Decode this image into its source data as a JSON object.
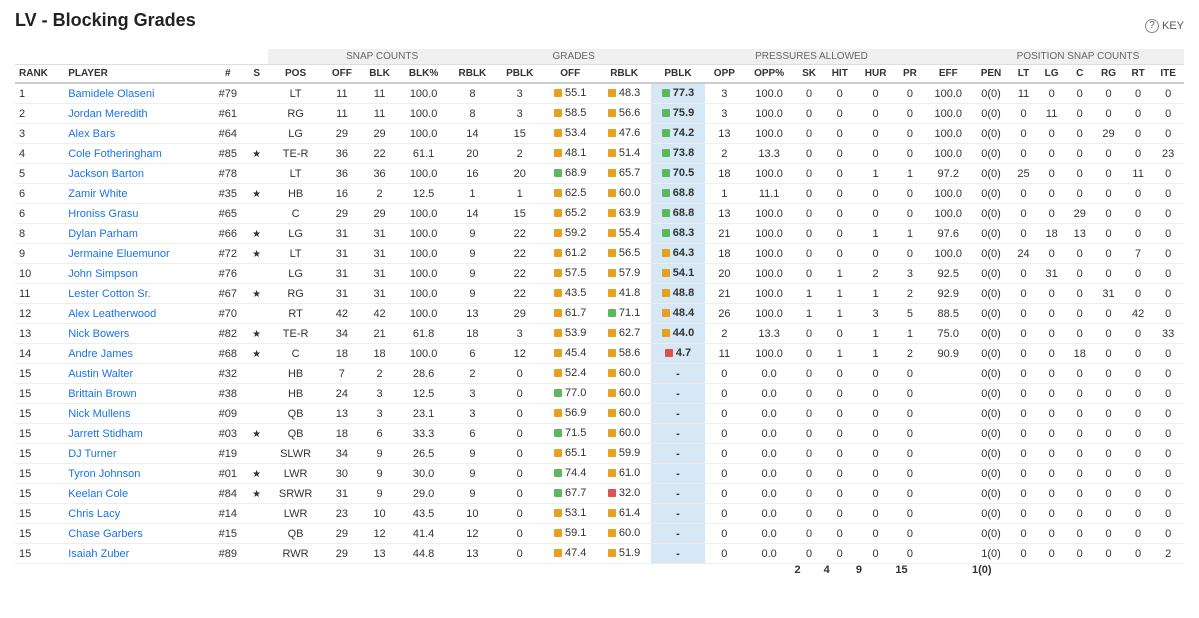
{
  "title": "LV - Blocking Grades",
  "key_label": "KEY",
  "group_headers": [
    {
      "label": "",
      "colspan": 4,
      "class": ""
    },
    {
      "label": "SNAP COUNTS",
      "colspan": 5,
      "class": "snap-counts"
    },
    {
      "label": "GRADES",
      "colspan": 3,
      "class": "grades"
    },
    {
      "label": "PRESSURES ALLOWED",
      "colspan": 8,
      "class": "pressures"
    },
    {
      "label": "POSITION SNAP COUNTS",
      "colspan": 7,
      "class": "pos-snap"
    }
  ],
  "col_headers": [
    "RANK",
    "PLAYER",
    "#",
    "S",
    "POS",
    "OFF",
    "BLK",
    "BLK%",
    "RBLK",
    "PBLK",
    "OFF",
    "RBLK",
    "PBLK",
    "OPP",
    "OPP%",
    "SK",
    "HIT",
    "HUR",
    "PR",
    "EFF",
    "PEN",
    "LT",
    "LG",
    "C",
    "RG",
    "RT",
    "ITE"
  ],
  "rows": [
    {
      "rank": "1",
      "player": "Bamidele Olaseni",
      "num": "#79",
      "star": false,
      "pos": "LT",
      "off": "11",
      "blk": "11",
      "blk_pct": "100.0",
      "rblk": "8",
      "pblk": "3",
      "off_grade": "55.1",
      "off_color": "#e8a020",
      "rblk_grade": "48.3",
      "rblk_color": "#e8a020",
      "pblk_grade": "77.3",
      "pblk_color": "#5cb85c",
      "opp": "3",
      "opp_pct": "100.0",
      "sk": "0",
      "hit": "0",
      "hur": "0",
      "pr": "0",
      "eff": "100.0",
      "pen": "0(0)",
      "lt": "11",
      "lg": "0",
      "c": "0",
      "rg": "0",
      "rt": "0",
      "ite": "0"
    },
    {
      "rank": "2",
      "player": "Jordan Meredith",
      "num": "#61",
      "star": false,
      "pos": "RG",
      "off": "11",
      "blk": "11",
      "blk_pct": "100.0",
      "rblk": "8",
      "pblk": "3",
      "off_grade": "58.5",
      "off_color": "#e8a020",
      "rblk_grade": "56.6",
      "rblk_color": "#e8a020",
      "pblk_grade": "75.9",
      "pblk_color": "#5cb85c",
      "opp": "3",
      "opp_pct": "100.0",
      "sk": "0",
      "hit": "0",
      "hur": "0",
      "pr": "0",
      "eff": "100.0",
      "pen": "0(0)",
      "lt": "0",
      "lg": "11",
      "c": "0",
      "rg": "0",
      "rt": "0",
      "ite": "0"
    },
    {
      "rank": "3",
      "player": "Alex Bars",
      "num": "#64",
      "star": false,
      "pos": "LG",
      "off": "29",
      "blk": "29",
      "blk_pct": "100.0",
      "rblk": "14",
      "pblk": "15",
      "off_grade": "53.4",
      "off_color": "#e8a020",
      "rblk_grade": "47.6",
      "rblk_color": "#e8a020",
      "pblk_grade": "74.2",
      "pblk_color": "#5cb85c",
      "opp": "13",
      "opp_pct": "100.0",
      "sk": "0",
      "hit": "0",
      "hur": "0",
      "pr": "0",
      "eff": "100.0",
      "pen": "0(0)",
      "lt": "0",
      "lg": "0",
      "c": "0",
      "rg": "29",
      "rt": "0",
      "ite": "0"
    },
    {
      "rank": "4",
      "player": "Cole Fotheringham",
      "num": "#85",
      "star": true,
      "pos": "TE-R",
      "off": "36",
      "blk": "22",
      "blk_pct": "61.1",
      "rblk": "20",
      "pblk": "2",
      "off_grade": "48.1",
      "off_color": "#e8a020",
      "rblk_grade": "51.4",
      "rblk_color": "#e8a020",
      "pblk_grade": "73.8",
      "pblk_color": "#5cb85c",
      "opp": "2",
      "opp_pct": "13.3",
      "sk": "0",
      "hit": "0",
      "hur": "0",
      "pr": "0",
      "eff": "100.0",
      "pen": "0(0)",
      "lt": "0",
      "lg": "0",
      "c": "0",
      "rg": "0",
      "rt": "0",
      "ite": "23"
    },
    {
      "rank": "5",
      "player": "Jackson Barton",
      "num": "#78",
      "star": false,
      "pos": "LT",
      "off": "36",
      "blk": "36",
      "blk_pct": "100.0",
      "rblk": "16",
      "pblk": "20",
      "off_grade": "68.9",
      "off_color": "#5cb85c",
      "rblk_grade": "65.7",
      "rblk_color": "#e8a020",
      "pblk_grade": "70.5",
      "pblk_color": "#5cb85c",
      "opp": "18",
      "opp_pct": "100.0",
      "sk": "0",
      "hit": "0",
      "hur": "1",
      "pr": "1",
      "eff": "97.2",
      "pen": "0(0)",
      "lt": "25",
      "lg": "0",
      "c": "0",
      "rg": "0",
      "rt": "11",
      "ite": "0"
    },
    {
      "rank": "6",
      "player": "Zamir White",
      "num": "#35",
      "star": true,
      "pos": "HB",
      "off": "16",
      "blk": "2",
      "blk_pct": "12.5",
      "rblk": "1",
      "pblk": "1",
      "off_grade": "62.5",
      "off_color": "#e8a020",
      "rblk_grade": "60.0",
      "rblk_color": "#e8a020",
      "pblk_grade": "68.8",
      "pblk_color": "#5cb85c",
      "opp": "1",
      "opp_pct": "11.1",
      "sk": "0",
      "hit": "0",
      "hur": "0",
      "pr": "0",
      "eff": "100.0",
      "pen": "0(0)",
      "lt": "0",
      "lg": "0",
      "c": "0",
      "rg": "0",
      "rt": "0",
      "ite": "0"
    },
    {
      "rank": "6",
      "player": "Hroniss Grasu",
      "num": "#65",
      "star": false,
      "pos": "C",
      "off": "29",
      "blk": "29",
      "blk_pct": "100.0",
      "rblk": "14",
      "pblk": "15",
      "off_grade": "65.2",
      "off_color": "#e8a020",
      "rblk_grade": "63.9",
      "rblk_color": "#e8a020",
      "pblk_grade": "68.8",
      "pblk_color": "#5cb85c",
      "opp": "13",
      "opp_pct": "100.0",
      "sk": "0",
      "hit": "0",
      "hur": "0",
      "pr": "0",
      "eff": "100.0",
      "pen": "0(0)",
      "lt": "0",
      "lg": "0",
      "c": "29",
      "rg": "0",
      "rt": "0",
      "ite": "0"
    },
    {
      "rank": "8",
      "player": "Dylan Parham",
      "num": "#66",
      "star": true,
      "pos": "LG",
      "off": "31",
      "blk": "31",
      "blk_pct": "100.0",
      "rblk": "9",
      "pblk": "22",
      "off_grade": "59.2",
      "off_color": "#e8a020",
      "rblk_grade": "55.4",
      "rblk_color": "#e8a020",
      "pblk_grade": "68.3",
      "pblk_color": "#5cb85c",
      "opp": "21",
      "opp_pct": "100.0",
      "sk": "0",
      "hit": "0",
      "hur": "1",
      "pr": "1",
      "eff": "97.6",
      "pen": "0(0)",
      "lt": "0",
      "lg": "18",
      "c": "13",
      "rg": "0",
      "rt": "0",
      "ite": "0"
    },
    {
      "rank": "9",
      "player": "Jermaine Eluemunor",
      "num": "#72",
      "star": true,
      "pos": "LT",
      "off": "31",
      "blk": "31",
      "blk_pct": "100.0",
      "rblk": "9",
      "pblk": "22",
      "off_grade": "61.2",
      "off_color": "#e8a020",
      "rblk_grade": "56.5",
      "rblk_color": "#e8a020",
      "pblk_grade": "64.3",
      "pblk_color": "#e8a020",
      "opp": "18",
      "opp_pct": "100.0",
      "sk": "0",
      "hit": "0",
      "hur": "0",
      "pr": "0",
      "eff": "100.0",
      "pen": "0(0)",
      "lt": "24",
      "lg": "0",
      "c": "0",
      "rg": "0",
      "rt": "7",
      "ite": "0"
    },
    {
      "rank": "10",
      "player": "John Simpson",
      "num": "#76",
      "star": false,
      "pos": "LG",
      "off": "31",
      "blk": "31",
      "blk_pct": "100.0",
      "rblk": "9",
      "pblk": "22",
      "off_grade": "57.5",
      "off_color": "#e8a020",
      "rblk_grade": "57.9",
      "rblk_color": "#e8a020",
      "pblk_grade": "54.1",
      "pblk_color": "#e8a020",
      "opp": "20",
      "opp_pct": "100.0",
      "sk": "0",
      "hit": "1",
      "hur": "2",
      "pr": "3",
      "eff": "92.5",
      "pen": "0(0)",
      "lt": "0",
      "lg": "31",
      "c": "0",
      "rg": "0",
      "rt": "0",
      "ite": "0"
    },
    {
      "rank": "11",
      "player": "Lester Cotton Sr.",
      "num": "#67",
      "star": true,
      "pos": "RG",
      "off": "31",
      "blk": "31",
      "blk_pct": "100.0",
      "rblk": "9",
      "pblk": "22",
      "off_grade": "43.5",
      "off_color": "#e8a020",
      "rblk_grade": "41.8",
      "rblk_color": "#e8a020",
      "pblk_grade": "48.8",
      "pblk_color": "#e8a020",
      "opp": "21",
      "opp_pct": "100.0",
      "sk": "1",
      "hit": "1",
      "hur": "1",
      "pr": "2",
      "eff": "92.9",
      "pen": "0(0)",
      "lt": "0",
      "lg": "0",
      "c": "0",
      "rg": "31",
      "rt": "0",
      "ite": "0"
    },
    {
      "rank": "12",
      "player": "Alex Leatherwood",
      "num": "#70",
      "star": false,
      "pos": "RT",
      "off": "42",
      "blk": "42",
      "blk_pct": "100.0",
      "rblk": "13",
      "pblk": "29",
      "off_grade": "61.7",
      "off_color": "#e8a020",
      "rblk_grade": "71.1",
      "rblk_color": "#5cb85c",
      "pblk_grade": "48.4",
      "pblk_color": "#e8a020",
      "opp": "26",
      "opp_pct": "100.0",
      "sk": "1",
      "hit": "1",
      "hur": "3",
      "pr": "5",
      "eff": "88.5",
      "pen": "0(0)",
      "lt": "0",
      "lg": "0",
      "c": "0",
      "rg": "0",
      "rt": "42",
      "ite": "0"
    },
    {
      "rank": "13",
      "player": "Nick Bowers",
      "num": "#82",
      "star": true,
      "pos": "TE-R",
      "off": "34",
      "blk": "21",
      "blk_pct": "61.8",
      "rblk": "18",
      "pblk": "3",
      "off_grade": "53.9",
      "off_color": "#e8a020",
      "rblk_grade": "62.7",
      "rblk_color": "#e8a020",
      "pblk_grade": "44.0",
      "pblk_color": "#e8a020",
      "opp": "2",
      "opp_pct": "13.3",
      "sk": "0",
      "hit": "0",
      "hur": "1",
      "pr": "1",
      "eff": "75.0",
      "pen": "0(0)",
      "lt": "0",
      "lg": "0",
      "c": "0",
      "rg": "0",
      "rt": "0",
      "ite": "33"
    },
    {
      "rank": "14",
      "player": "Andre James",
      "num": "#68",
      "star": true,
      "pos": "C",
      "off": "18",
      "blk": "18",
      "blk_pct": "100.0",
      "rblk": "6",
      "pblk": "12",
      "off_grade": "45.4",
      "off_color": "#e8a020",
      "rblk_grade": "58.6",
      "rblk_color": "#e8a020",
      "pblk_grade": "4.7",
      "pblk_color": "#d9534f",
      "opp": "11",
      "opp_pct": "100.0",
      "sk": "0",
      "hit": "1",
      "hur": "1",
      "pr": "2",
      "eff": "90.9",
      "pen": "0(0)",
      "lt": "0",
      "lg": "0",
      "c": "18",
      "rg": "0",
      "rt": "0",
      "ite": "0"
    },
    {
      "rank": "15",
      "player": "Austin Walter",
      "num": "#32",
      "star": false,
      "pos": "HB",
      "off": "7",
      "blk": "2",
      "blk_pct": "28.6",
      "rblk": "2",
      "pblk": "0",
      "off_grade": "52.4",
      "off_color": "#e8a020",
      "rblk_grade": "60.0",
      "rblk_color": "#e8a020",
      "pblk_grade": "-",
      "pblk_color": "",
      "opp": "0",
      "opp_pct": "0.0",
      "sk": "0",
      "hit": "0",
      "hur": "0",
      "pr": "0",
      "eff": "",
      "pen": "0(0)",
      "lt": "0",
      "lg": "0",
      "c": "0",
      "rg": "0",
      "rt": "0",
      "ite": "0"
    },
    {
      "rank": "15",
      "player": "Brittain Brown",
      "num": "#38",
      "star": false,
      "pos": "HB",
      "off": "24",
      "blk": "3",
      "blk_pct": "12.5",
      "rblk": "3",
      "pblk": "0",
      "off_grade": "77.0",
      "off_color": "#5cb85c",
      "rblk_grade": "60.0",
      "rblk_color": "#e8a020",
      "pblk_grade": "-",
      "pblk_color": "",
      "opp": "0",
      "opp_pct": "0.0",
      "sk": "0",
      "hit": "0",
      "hur": "0",
      "pr": "0",
      "eff": "",
      "pen": "0(0)",
      "lt": "0",
      "lg": "0",
      "c": "0",
      "rg": "0",
      "rt": "0",
      "ite": "0"
    },
    {
      "rank": "15",
      "player": "Nick Mullens",
      "num": "#09",
      "star": false,
      "pos": "QB",
      "off": "13",
      "blk": "3",
      "blk_pct": "23.1",
      "rblk": "3",
      "pblk": "0",
      "off_grade": "56.9",
      "off_color": "#e8a020",
      "rblk_grade": "60.0",
      "rblk_color": "#e8a020",
      "pblk_grade": "-",
      "pblk_color": "",
      "opp": "0",
      "opp_pct": "0.0",
      "sk": "0",
      "hit": "0",
      "hur": "0",
      "pr": "0",
      "eff": "",
      "pen": "0(0)",
      "lt": "0",
      "lg": "0",
      "c": "0",
      "rg": "0",
      "rt": "0",
      "ite": "0"
    },
    {
      "rank": "15",
      "player": "Jarrett Stidham",
      "num": "#03",
      "star": true,
      "pos": "QB",
      "off": "18",
      "blk": "6",
      "blk_pct": "33.3",
      "rblk": "6",
      "pblk": "0",
      "off_grade": "71.5",
      "off_color": "#5cb85c",
      "rblk_grade": "60.0",
      "rblk_color": "#e8a020",
      "pblk_grade": "-",
      "pblk_color": "",
      "opp": "0",
      "opp_pct": "0.0",
      "sk": "0",
      "hit": "0",
      "hur": "0",
      "pr": "0",
      "eff": "",
      "pen": "0(0)",
      "lt": "0",
      "lg": "0",
      "c": "0",
      "rg": "0",
      "rt": "0",
      "ite": "0"
    },
    {
      "rank": "15",
      "player": "DJ Turner",
      "num": "#19",
      "star": false,
      "pos": "SLWR",
      "off": "34",
      "blk": "9",
      "blk_pct": "26.5",
      "rblk": "9",
      "pblk": "0",
      "off_grade": "65.1",
      "off_color": "#e8a020",
      "rblk_grade": "59.9",
      "rblk_color": "#e8a020",
      "pblk_grade": "-",
      "pblk_color": "",
      "opp": "0",
      "opp_pct": "0.0",
      "sk": "0",
      "hit": "0",
      "hur": "0",
      "pr": "0",
      "eff": "",
      "pen": "0(0)",
      "lt": "0",
      "lg": "0",
      "c": "0",
      "rg": "0",
      "rt": "0",
      "ite": "0"
    },
    {
      "rank": "15",
      "player": "Tyron Johnson",
      "num": "#01",
      "star": true,
      "pos": "LWR",
      "off": "30",
      "blk": "9",
      "blk_pct": "30.0",
      "rblk": "9",
      "pblk": "0",
      "off_grade": "74.4",
      "off_color": "#5cb85c",
      "rblk_grade": "61.0",
      "rblk_color": "#e8a020",
      "pblk_grade": "-",
      "pblk_color": "",
      "opp": "0",
      "opp_pct": "0.0",
      "sk": "0",
      "hit": "0",
      "hur": "0",
      "pr": "0",
      "eff": "",
      "pen": "0(0)",
      "lt": "0",
      "lg": "0",
      "c": "0",
      "rg": "0",
      "rt": "0",
      "ite": "0"
    },
    {
      "rank": "15",
      "player": "Keelan Cole",
      "num": "#84",
      "star": true,
      "pos": "SRWR",
      "off": "31",
      "blk": "9",
      "blk_pct": "29.0",
      "rblk": "9",
      "pblk": "0",
      "off_grade": "67.7",
      "off_color": "#5cb85c",
      "rblk_grade": "32.0",
      "rblk_color": "#d9534f",
      "pblk_grade": "-",
      "pblk_color": "",
      "opp": "0",
      "opp_pct": "0.0",
      "sk": "0",
      "hit": "0",
      "hur": "0",
      "pr": "0",
      "eff": "",
      "pen": "0(0)",
      "lt": "0",
      "lg": "0",
      "c": "0",
      "rg": "0",
      "rt": "0",
      "ite": "0"
    },
    {
      "rank": "15",
      "player": "Chris Lacy",
      "num": "#14",
      "star": false,
      "pos": "LWR",
      "off": "23",
      "blk": "10",
      "blk_pct": "43.5",
      "rblk": "10",
      "pblk": "0",
      "off_grade": "53.1",
      "off_color": "#e8a020",
      "rblk_grade": "61.4",
      "rblk_color": "#e8a020",
      "pblk_grade": "-",
      "pblk_color": "",
      "opp": "0",
      "opp_pct": "0.0",
      "sk": "0",
      "hit": "0",
      "hur": "0",
      "pr": "0",
      "eff": "",
      "pen": "0(0)",
      "lt": "0",
      "lg": "0",
      "c": "0",
      "rg": "0",
      "rt": "0",
      "ite": "0"
    },
    {
      "rank": "15",
      "player": "Chase Garbers",
      "num": "#15",
      "star": false,
      "pos": "QB",
      "off": "29",
      "blk": "12",
      "blk_pct": "41.4",
      "rblk": "12",
      "pblk": "0",
      "off_grade": "59.1",
      "off_color": "#e8a020",
      "rblk_grade": "60.0",
      "rblk_color": "#e8a020",
      "pblk_grade": "-",
      "pblk_color": "",
      "opp": "0",
      "opp_pct": "0.0",
      "sk": "0",
      "hit": "0",
      "hur": "0",
      "pr": "0",
      "eff": "",
      "pen": "0(0)",
      "lt": "0",
      "lg": "0",
      "c": "0",
      "rg": "0",
      "rt": "0",
      "ite": "0"
    },
    {
      "rank": "15",
      "player": "Isaiah Zuber",
      "num": "#89",
      "star": false,
      "pos": "RWR",
      "off": "29",
      "blk": "13",
      "blk_pct": "44.8",
      "rblk": "13",
      "pblk": "0",
      "off_grade": "47.4",
      "off_color": "#e8a020",
      "rblk_grade": "51.9",
      "rblk_color": "#e8a020",
      "pblk_grade": "-",
      "pblk_color": "",
      "opp": "0",
      "opp_pct": "0.0",
      "sk": "0",
      "hit": "0",
      "hur": "0",
      "pr": "0",
      "eff": "",
      "pen": "1(0)",
      "lt": "0",
      "lg": "0",
      "c": "0",
      "rg": "0",
      "rt": "0",
      "ite": "2"
    }
  ],
  "totals": {
    "sk": "2",
    "hit": "4",
    "hur": "9",
    "pr": "15",
    "pen": "1(0)"
  }
}
